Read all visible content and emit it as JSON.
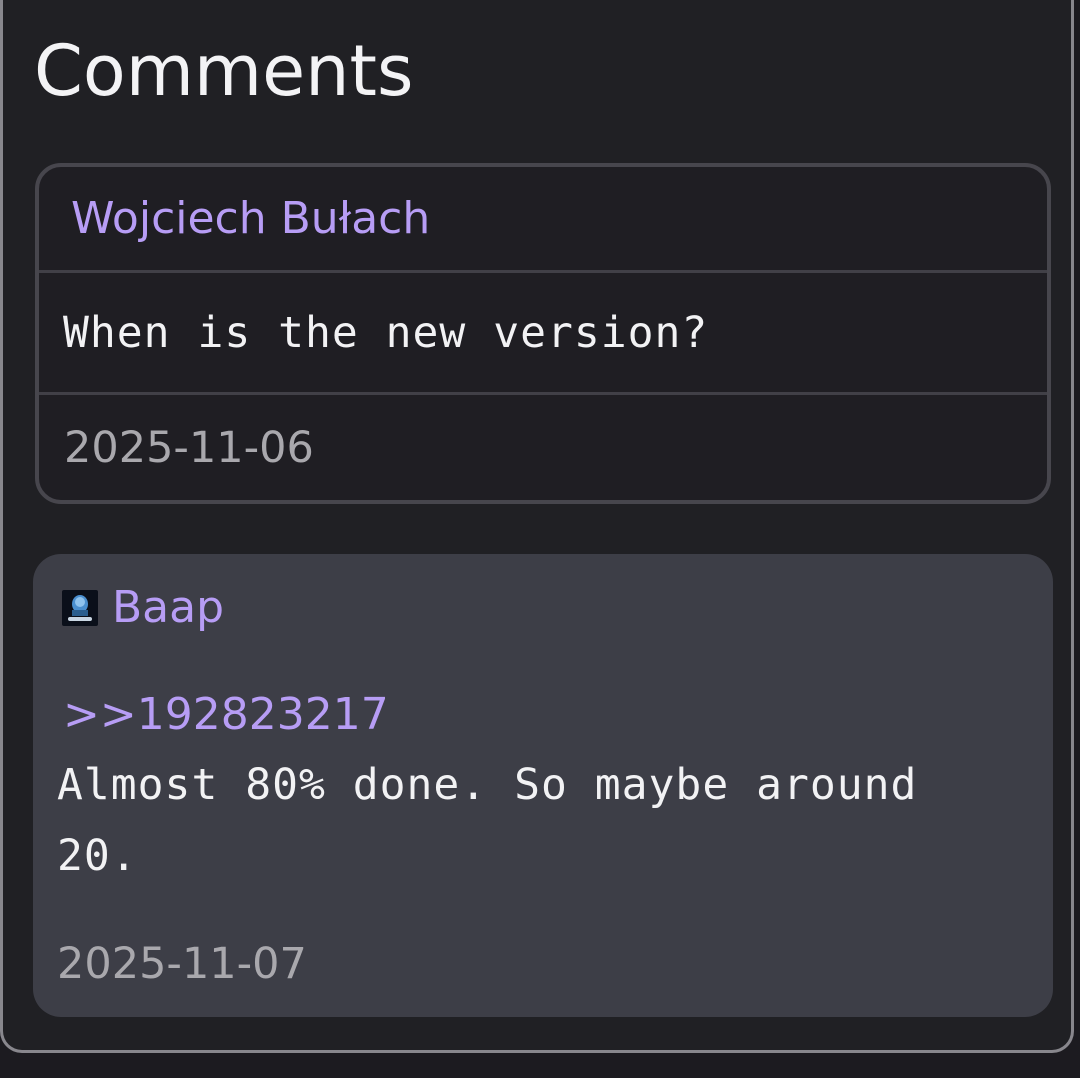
{
  "page": {
    "title": "Comments"
  },
  "comments": [
    {
      "author": "Wojciech Bułach",
      "text": "When is the new version?",
      "date": "2025-11-06"
    },
    {
      "author": "Baap",
      "has_avatar": true,
      "reply_to": ">>192823217",
      "text": "Almost 80% done. So maybe around 20.",
      "date": "2025-11-07"
    }
  ],
  "colors": {
    "background": "#202024",
    "author_link": "#b79df5",
    "highlighted_card": "#3d3e47",
    "card_border": "#47464d",
    "date_text": "#a9a8ad"
  }
}
